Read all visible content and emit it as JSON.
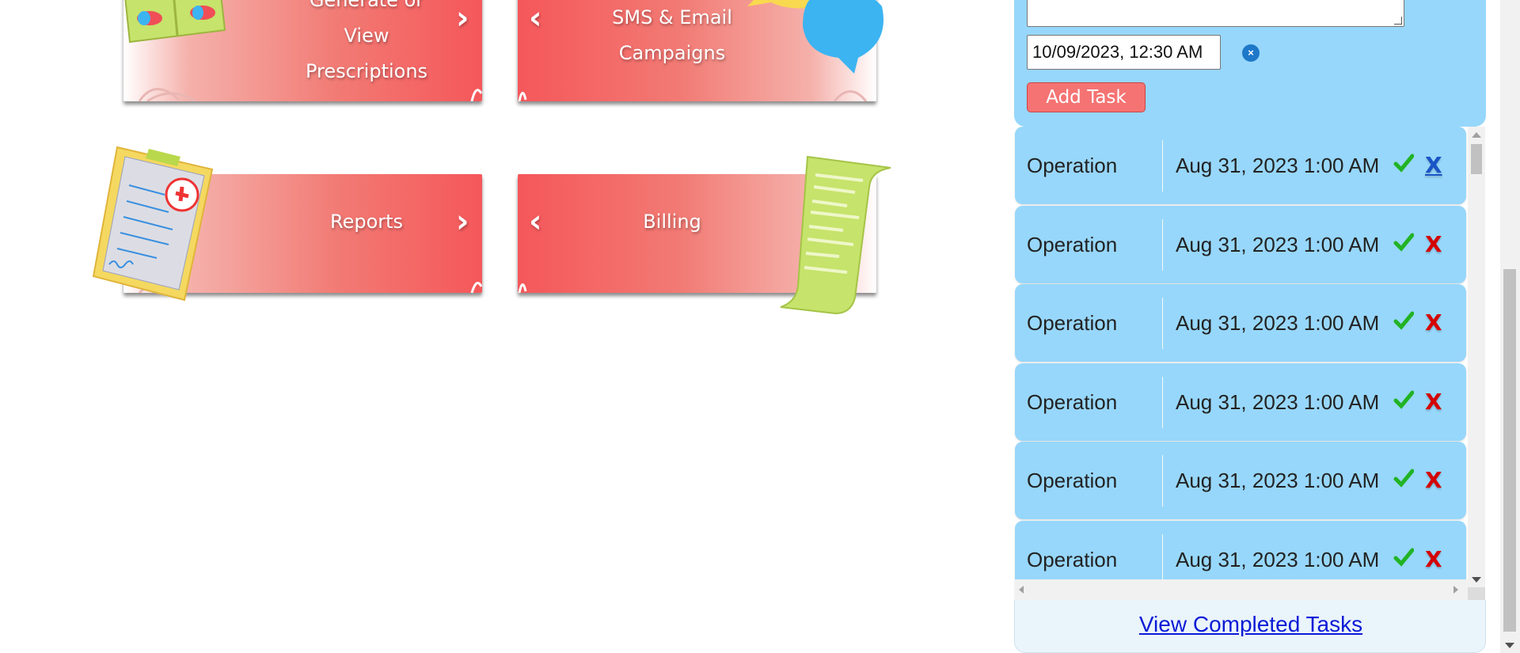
{
  "tiles": [
    {
      "label_lines": [
        "Generate or",
        "View",
        "Prescriptions"
      ],
      "art": "pills-icon"
    },
    {
      "label_lines": [
        "SMS & Email",
        "Campaigns"
      ],
      "art": "chat-bubbles-icon"
    },
    {
      "label_lines": [
        "Reports"
      ],
      "art": "clipboard-icon"
    },
    {
      "label_lines": [
        "Billing"
      ],
      "art": "receipt-icon"
    }
  ],
  "task_form": {
    "datetime_value": "10/09/2023, 12:30 AM",
    "clear_symbol": "×",
    "add_button": "Add Task"
  },
  "tasks": [
    {
      "name": "Operation",
      "date": "Aug 31, 2023 1:00 AM",
      "done_icon": "check-icon",
      "delete_label": "X"
    },
    {
      "name": "Operation",
      "date": "Aug 31, 2023 1:00 AM",
      "done_icon": "check-icon",
      "delete_label": "X"
    },
    {
      "name": "Operation",
      "date": "Aug 31, 2023 1:00 AM",
      "done_icon": "check-icon",
      "delete_label": "X"
    },
    {
      "name": "Operation",
      "date": "Aug 31, 2023 1:00 AM",
      "done_icon": "check-icon",
      "delete_label": "X"
    },
    {
      "name": "Operation",
      "date": "Aug 31, 2023 1:00 AM",
      "done_icon": "check-icon",
      "delete_label": "X"
    },
    {
      "name": "Operation",
      "date": "Aug 31, 2023 1:00 AM",
      "done_icon": "check-icon",
      "delete_label": "X"
    }
  ],
  "footer": {
    "view_completed": "View Completed Tasks"
  },
  "colors": {
    "tile_red": "#f5575a",
    "panel_blue": "#97d7fb",
    "add_button": "#f57373",
    "delete_red": "#d40000",
    "check_green": "#21b324",
    "link_blue": "#0a1ad6"
  }
}
